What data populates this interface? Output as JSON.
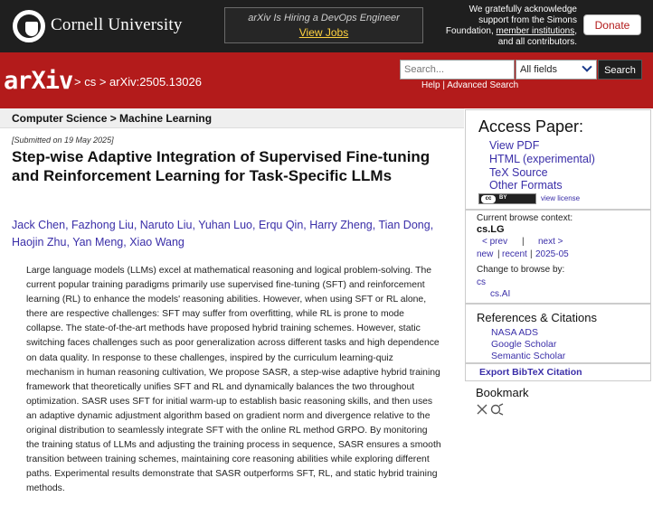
{
  "topbar": {
    "university": "Cornell University",
    "jobs_title": "arXiv Is Hiring a DevOps Engineer",
    "jobs_link": "View Jobs",
    "ack_line1": "We gratefully acknowledge",
    "ack_line2": "support from the Simons",
    "ack_line3_pre": "Foundation, ",
    "ack_line3_link": "member institutions",
    "ack_line3_post": ",",
    "ack_line4": "and all contributors.",
    "donate": "Donate"
  },
  "header": {
    "logo": "arXiv",
    "breadcrumb": "> cs > arXiv:2505.13026",
    "search_placeholder": "Search...",
    "search_field": "All fields",
    "search_button": "Search",
    "help": "Help",
    "advanced_search": "Advanced Search",
    "help_sep": "|"
  },
  "paper": {
    "subject": "Computer Science > Machine Learning",
    "submitted": "[Submitted on 19 May 2025]",
    "title": "Step-wise Adaptive Integration of Supervised Fine-tuning and Reinforcement Learning for Task-Specific LLMs",
    "authors": [
      "Jack Chen",
      "Fazhong Liu",
      "Naruto Liu",
      "Yuhan Luo",
      "Erqu Qin",
      "Harry Zheng",
      "Tian Dong",
      "Haojin Zhu",
      "Yan Meng",
      "Xiao Wang"
    ],
    "abstract": "Large language models (LLMs) excel at mathematical reasoning and logical problem-solving. The current popular training paradigms primarily use supervised fine-tuning (SFT) and reinforcement learning (RL) to enhance the models' reasoning abilities. However, when using SFT or RL alone, there are respective challenges: SFT may suffer from overfitting, while RL is prone to mode collapse. The state-of-the-art methods have proposed hybrid training schemes. However, static switching faces challenges such as poor generalization across different tasks and high dependence on data quality. In response to these challenges, inspired by the curriculum learning-quiz mechanism in human reasoning cultivation, We propose SASR, a step-wise adaptive hybrid training framework that theoretically unifies SFT and RL and dynamically balances the two throughout optimization. SASR uses SFT for initial warm-up to establish basic reasoning skills, and then uses an adaptive dynamic adjustment algorithm based on gradient norm and divergence relative to the original distribution to seamlessly integrate SFT with the online RL method GRPO. By monitoring the training status of LLMs and adjusting the training process in sequence, SASR ensures a smooth transition between training schemes, maintaining core reasoning abilities while exploring different paths. Experimental results demonstrate that SASR outperforms SFT, RL, and static hybrid training methods."
  },
  "sidebar": {
    "access_title": "Access Paper:",
    "links": [
      "View PDF",
      "HTML (experimental)",
      "TeX Source",
      "Other Formats"
    ],
    "cc_text": "cc",
    "by_text": "BY",
    "view_license": "view license",
    "browse_context_label": "Current browse context:",
    "browse_context": "cs.LG",
    "prev": "< prev",
    "next": "next >",
    "sep": "|",
    "new": "new",
    "recent": "recent",
    "month": "2025-05",
    "change_browse": "Change to browse by:",
    "browse_cs": "cs",
    "browse_csai": "cs.AI",
    "refs_title": "References & Citations",
    "refs": [
      "NASA ADS",
      "Google Scholar",
      "Semantic Scholar"
    ],
    "bibtex": "Export BibTeX Citation",
    "bookmark": "Bookmark"
  },
  "colors": {
    "arxiv_red": "#b31b1b",
    "link_purple": "#3a2ea8",
    "dark_bar": "#1f1f1f",
    "jobs_yellow": "#ffd23f"
  }
}
